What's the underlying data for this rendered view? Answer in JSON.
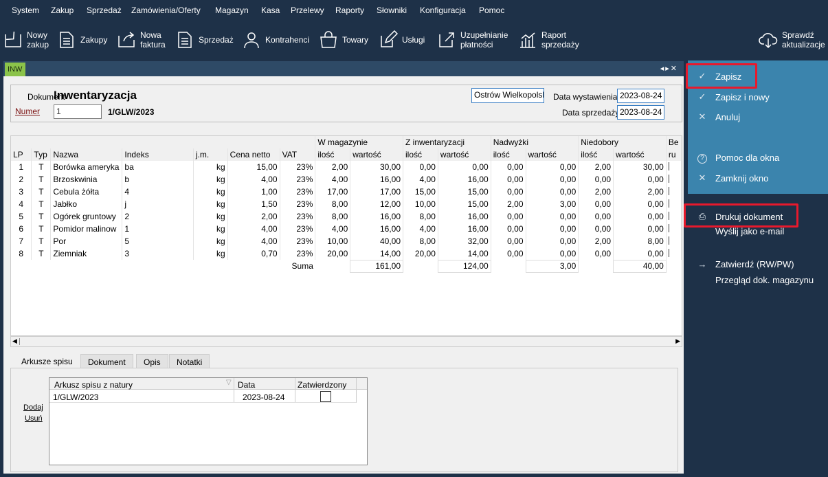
{
  "menu": [
    "System",
    "Zakup",
    "Sprzedaż",
    "Zamówienia/Oferty",
    "Magazyn",
    "Kasa",
    "Przelewy",
    "Raporty",
    "Słowniki",
    "Konfiguracja",
    "Pomoc"
  ],
  "toolbar": {
    "nowy_zakup": [
      "Nowy",
      "zakup"
    ],
    "zakupy": "Zakupy",
    "nowa_faktura": [
      "Nowa",
      "faktura"
    ],
    "sprzedaz": "Sprzedaż",
    "kontrahenci": "Kontrahenci",
    "towary": "Towary",
    "uslugi": "Usługi",
    "uzupelnianie": [
      "Uzupełnianie",
      "płatności"
    ],
    "raport": [
      "Raport",
      "sprzedaży"
    ],
    "sprawdz": [
      "Sprawdź",
      "aktualizacje"
    ]
  },
  "tab": {
    "label": "INW"
  },
  "document": {
    "label": "Dokument",
    "title": "Inwentaryzacja",
    "numer_label": "Numer",
    "numer_value": "1",
    "numer_full": "1/GLW/2023",
    "location": "Ostrów Wielkopolski",
    "data_wystawienia_label": "Data wystawienia",
    "data_wystawienia": "2023-08-24",
    "data_sprzedazy_label": "Data sprzedaży",
    "data_sprzedazy": "2023-08-24"
  },
  "grid": {
    "groups": {
      "w_magazynie": "W magazynie",
      "z_inwentaryzacji": "Z inwentaryzacji",
      "nadwyzki": "Nadwyżki",
      "niedobory": "Niedobory",
      "more": "Be"
    },
    "headers": [
      "LP",
      "Typ",
      "Nazwa",
      "Indeks",
      "j.m.",
      "Cena netto",
      "VAT",
      "ilość",
      "wartość",
      "ilość",
      "wartość",
      "ilość",
      "wartość",
      "ilość",
      "wartość",
      "ru"
    ],
    "rows": [
      [
        "1",
        "T",
        "Borówka ameryka",
        "ba",
        "kg",
        "15,00",
        "23%",
        "2,00",
        "30,00",
        "0,00",
        "0,00",
        "0,00",
        "0,00",
        "2,00",
        "30,00"
      ],
      [
        "2",
        "T",
        "Brzoskwinia",
        "b",
        "kg",
        "4,00",
        "23%",
        "4,00",
        "16,00",
        "4,00",
        "16,00",
        "0,00",
        "0,00",
        "0,00",
        "0,00"
      ],
      [
        "3",
        "T",
        "Cebula żółta",
        "4",
        "kg",
        "1,00",
        "23%",
        "17,00",
        "17,00",
        "15,00",
        "15,00",
        "0,00",
        "0,00",
        "2,00",
        "2,00"
      ],
      [
        "4",
        "T",
        "Jabłko",
        "j",
        "kg",
        "1,50",
        "23%",
        "8,00",
        "12,00",
        "10,00",
        "15,00",
        "2,00",
        "3,00",
        "0,00",
        "0,00"
      ],
      [
        "5",
        "T",
        "Ogórek gruntowy",
        "2",
        "kg",
        "2,00",
        "23%",
        "8,00",
        "16,00",
        "8,00",
        "16,00",
        "0,00",
        "0,00",
        "0,00",
        "0,00"
      ],
      [
        "6",
        "T",
        "Pomidor malinow",
        "1",
        "kg",
        "4,00",
        "23%",
        "4,00",
        "16,00",
        "4,00",
        "16,00",
        "0,00",
        "0,00",
        "0,00",
        "0,00"
      ],
      [
        "7",
        "T",
        "Por",
        "5",
        "kg",
        "4,00",
        "23%",
        "10,00",
        "40,00",
        "8,00",
        "32,00",
        "0,00",
        "0,00",
        "2,00",
        "8,00"
      ],
      [
        "8",
        "T",
        "Ziemniak",
        "3",
        "kg",
        "0,70",
        "23%",
        "20,00",
        "14,00",
        "20,00",
        "14,00",
        "0,00",
        "0,00",
        "0,00",
        "0,00"
      ]
    ],
    "suma_label": "Suma",
    "suma": {
      "w_magazynie": "161,00",
      "z_inwentaryzacji": "124,00",
      "nadwyzki": "3,00",
      "niedobory": "40,00"
    }
  },
  "bottom_tabs": [
    "Arkusze spisu",
    "Dokument",
    "Opis",
    "Notatki"
  ],
  "arkusze": {
    "headers": [
      "Arkusz spisu z natury",
      "Data",
      "Zatwierdzony"
    ],
    "row": {
      "arkusz": "1/GLW/2023",
      "data": "2023-08-24"
    },
    "dodaj": "Dodaj",
    "usun": "Usuń"
  },
  "actions": {
    "zapisz": "Zapisz",
    "zapisz_nowy": "Zapisz i nowy",
    "anuluj": "Anuluj",
    "pomoc": "Pomoc dla okna",
    "zamknij": "Zamknij okno",
    "drukuj": "Drukuj dokument",
    "wyslij": "Wyślij jako e-mail",
    "zatwierdz": "Zatwierdź (RW/PW)",
    "przeglad": "Przegląd dok. magazynu"
  },
  "colors": {
    "background": "#1e3148",
    "action_panel": "#3b84ad",
    "tab_accent": "#8bc34a",
    "highlight": "#e8192c"
  }
}
